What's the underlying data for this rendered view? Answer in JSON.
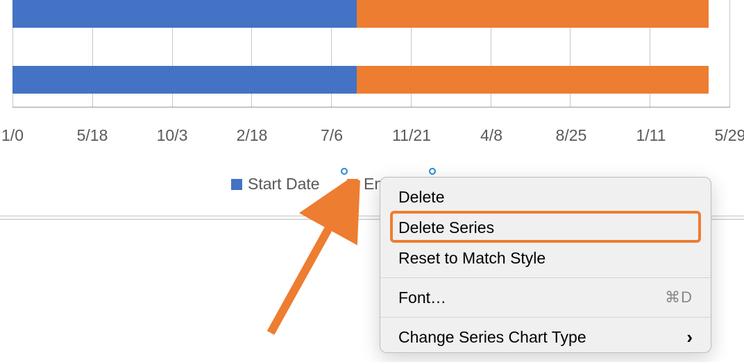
{
  "chart_data": {
    "type": "bar",
    "orientation": "horizontal",
    "stacked": true,
    "x_ticks": [
      "1/0",
      "5/18",
      "10/3",
      "2/18",
      "7/6",
      "11/21",
      "4/8",
      "8/25",
      "1/11",
      "5/29"
    ],
    "series": [
      {
        "name": "Start Date",
        "color": "#4472C4",
        "values": [
          0.48,
          0.48
        ]
      },
      {
        "name": "End Date",
        "color": "#ED7D31",
        "values": [
          0.49,
          0.49
        ]
      }
    ],
    "row_count": 2
  },
  "legend": {
    "series_a": "Start Date",
    "series_b_visible": "En"
  },
  "context_menu": {
    "items": {
      "delete": "Delete",
      "delete_series": "Delete Series",
      "reset": "Reset to Match Style",
      "font": "Font…",
      "font_shortcut": "⌘D",
      "change_type": "Change Series Chart Type"
    }
  }
}
